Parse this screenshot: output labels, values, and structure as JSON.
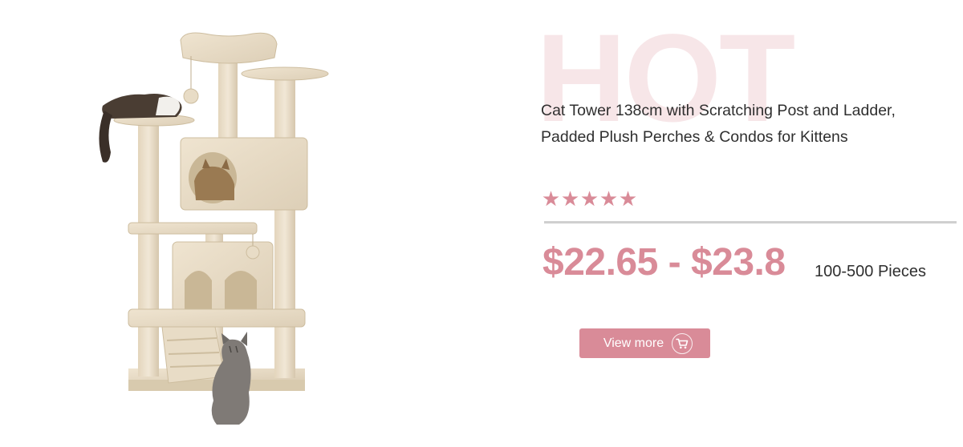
{
  "watermark": "HOT",
  "product": {
    "title_line1": "Cat Tower 138cm with Scratching Post and Ladder,",
    "title_line2": "Padded Plush Perches & Condos for Kittens",
    "rating": 5,
    "stars": [
      "★",
      "★",
      "★",
      "★",
      "★"
    ],
    "price": "$22.65 - $23.8",
    "quantity": "100-500 Pieces",
    "image_icon": "cat-tower-image"
  },
  "cta": {
    "label": "View more",
    "icon": "cart-icon"
  },
  "colors": {
    "accent": "#d98b98",
    "watermark": "#f7e6e8",
    "text": "#2f2f2f",
    "divider": "#cfcfcf"
  }
}
